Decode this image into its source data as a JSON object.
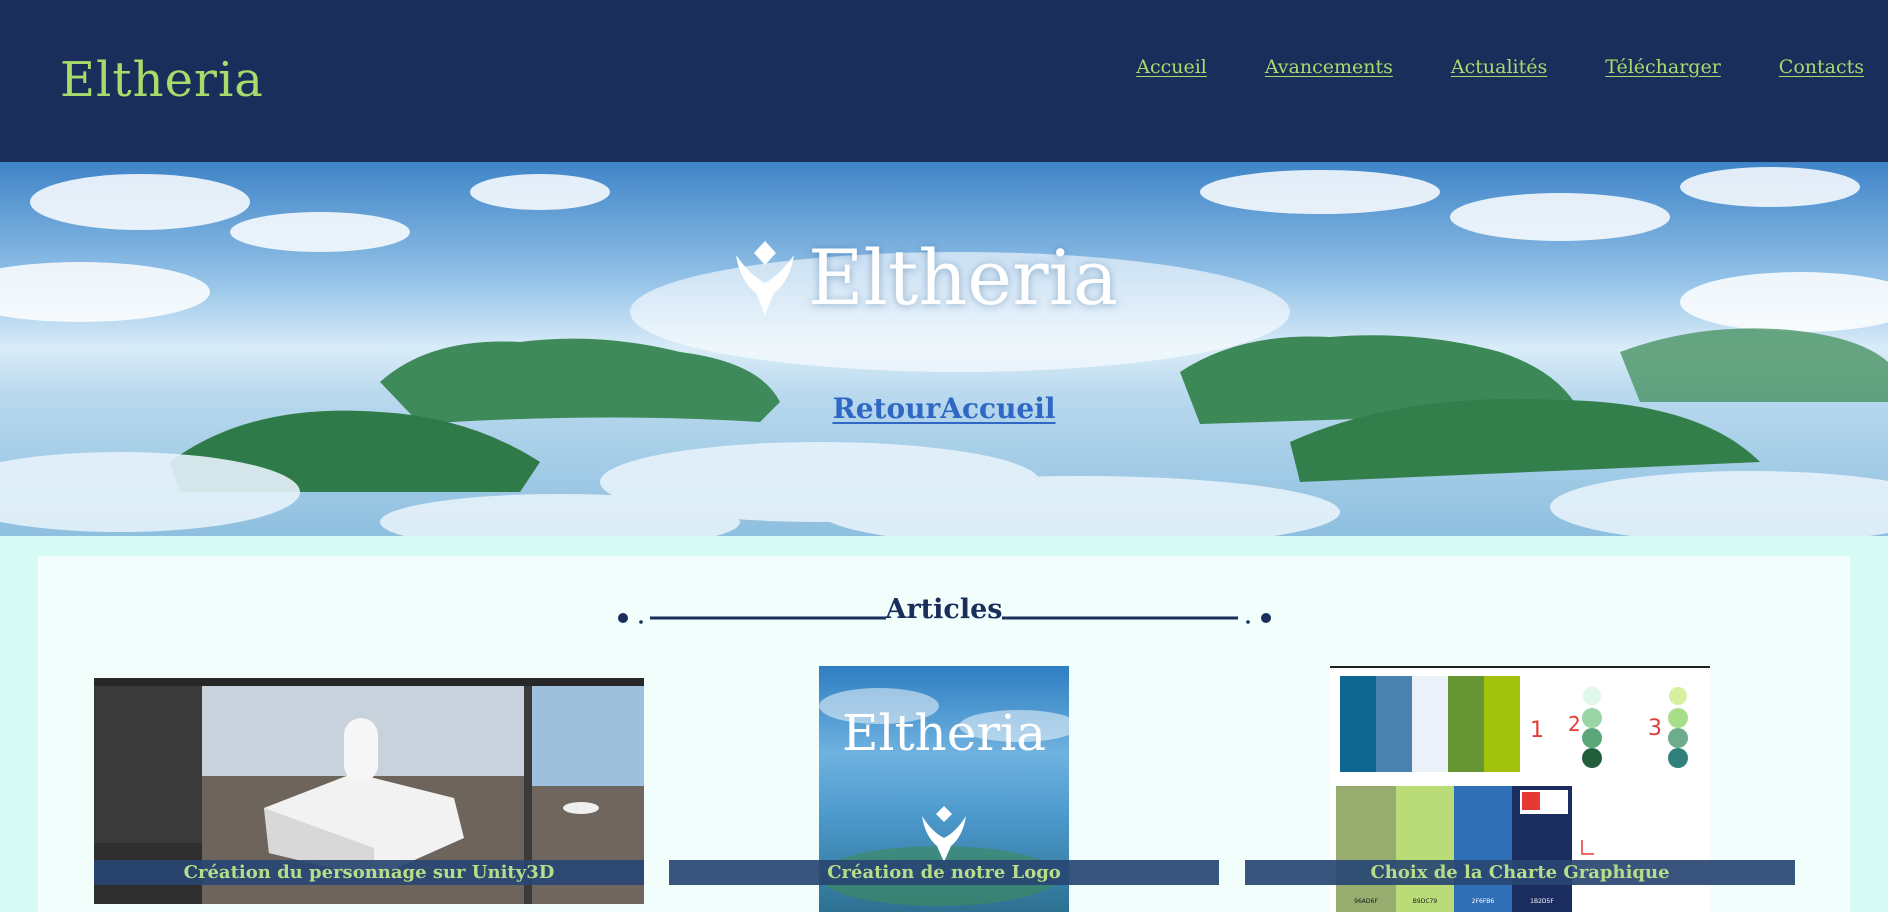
{
  "brand": {
    "logo_text": "Eltheria",
    "accent_color": "#a8dc6a",
    "header_bg": "#1a2e5c"
  },
  "nav": {
    "items": [
      {
        "label": "Accueil"
      },
      {
        "label": "Avancements"
      },
      {
        "label": "Actualités"
      },
      {
        "label": "Télécharger"
      },
      {
        "label": "Contacts"
      }
    ]
  },
  "hero": {
    "logo_text": "Eltheria",
    "link_label": "RetourAccueil",
    "link_color": "#2f67c4"
  },
  "articles": {
    "title": "Articles",
    "cards": [
      {
        "caption": "Création du personnage sur Unity3D"
      },
      {
        "caption": "Création de notre Logo",
        "thumb_text": "Eltheria"
      },
      {
        "caption": "Choix de la Charte Graphique",
        "palette_numbers": [
          "1",
          "2",
          "3"
        ],
        "swatch_codes": [
          "96AD6F",
          "B9DC79",
          "2F6FB6",
          "1B2D5F"
        ]
      }
    ]
  }
}
